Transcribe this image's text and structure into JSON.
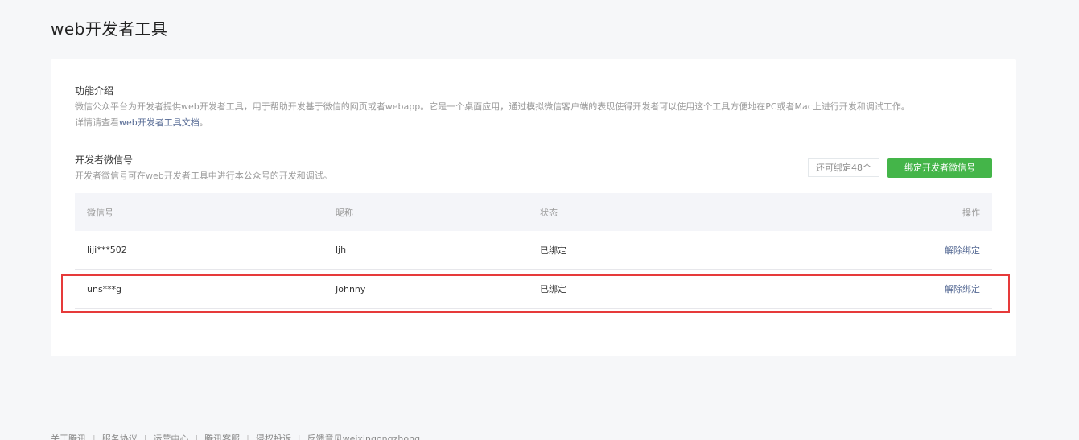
{
  "page": {
    "title": "web开发者工具"
  },
  "intro": {
    "title": "功能介绍",
    "description": "微信公众平台为开发者提供web开发者工具，用于帮助开发基于微信的网页或者webapp。它是一个桌面应用，通过模拟微信客户端的表现使得开发者可以使用这个工具方便地在PC或者Mac上进行开发和调试工作。",
    "detail_prefix": "详情请查看",
    "detail_link": "web开发者工具文档",
    "detail_suffix": "。"
  },
  "developer": {
    "title": "开发者微信号",
    "description": "开发者微信号可在web开发者工具中进行本公众号的开发和调试。",
    "quota": "还可绑定48个",
    "bind_button": "绑定开发者微信号"
  },
  "table": {
    "headers": {
      "wechat_id": "微信号",
      "nickname": "昵称",
      "status": "状态",
      "action": "操作"
    },
    "rows": [
      {
        "wechat_id": "liji***502",
        "nickname": "ljh",
        "status": "已绑定",
        "action": "解除绑定"
      },
      {
        "wechat_id": "uns***g",
        "nickname": "Johnny",
        "status": "已绑定",
        "action": "解除绑定"
      }
    ]
  },
  "footer": {
    "links": [
      "关于腾讯",
      "服务协议",
      "运营中心",
      "腾讯客服",
      "侵权投诉",
      "反馈意见weixingongzhong"
    ]
  },
  "colors": {
    "accent_green": "#44b549",
    "link_blue": "#576b95",
    "highlight_red": "#e63a3a"
  }
}
